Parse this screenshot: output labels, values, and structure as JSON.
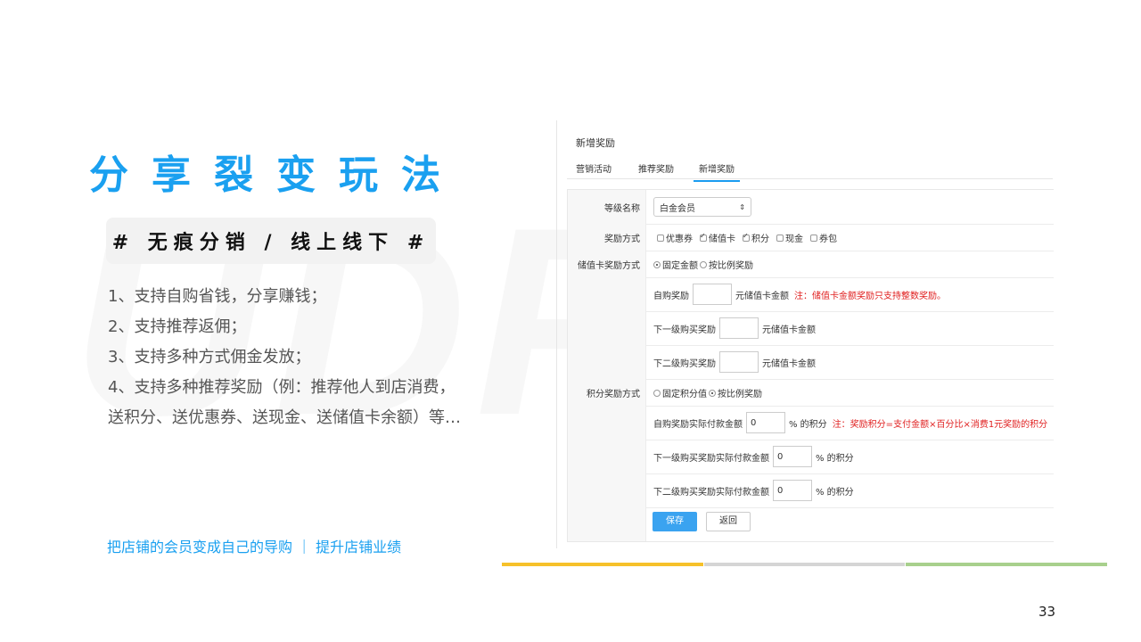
{
  "slide": {
    "title": "分享裂变玩法",
    "tag": "# 无痕分销 / 线上线下 #",
    "features": [
      "1、支持自购省钱，分享赚钱；",
      "2、支持推荐返佣；",
      "3、支持多种方式佣金发放；",
      "4、支持多种推荐奖励（例：推荐他人到店消费，",
      "送积分、送优惠券、送现金、送储值卡余额）等…"
    ],
    "slogan": "把店铺的会员变成自己的导购 ｜ 提升店铺业绩",
    "page_number": "33",
    "bar_colors": [
      "#f6c12a",
      "#d5d5d5",
      "#a8d08d"
    ]
  },
  "panel": {
    "title": "新增奖励",
    "tabs": [
      "营销活动",
      "推荐奖励",
      "新增奖励"
    ],
    "active_tab": "新增奖励",
    "accent_color": "#1a9cf0",
    "level": {
      "label": "等级名称",
      "value": "白金会员"
    },
    "reward_type": {
      "label": "奖励方式",
      "options": [
        {
          "label": "优惠券",
          "checked": false
        },
        {
          "label": "储值卡",
          "checked": true
        },
        {
          "label": "积分",
          "checked": true
        },
        {
          "label": "现金",
          "checked": false
        },
        {
          "label": "券包",
          "checked": false
        }
      ]
    },
    "card_reward": {
      "label": "储值卡奖励方式",
      "options": [
        {
          "label": "固定金额",
          "selected": true
        },
        {
          "label": "按比例奖励",
          "selected": false
        }
      ],
      "self_label": "自购奖励",
      "self_value": "",
      "self_unit": "元储值卡金额",
      "note": "注：储值卡金额奖励只支持整数奖励。",
      "level1_label": "下一级购买奖励",
      "level1_value": "",
      "level1_unit": "元储值卡金额",
      "level2_label": "下二级购买奖励",
      "level2_value": "",
      "level2_unit": "元储值卡金额"
    },
    "points_reward": {
      "label": "积分奖励方式",
      "options": [
        {
          "label": "固定积分值",
          "selected": false
        },
        {
          "label": "按比例奖励",
          "selected": true
        }
      ],
      "self_label": "自购奖励实际付款金额",
      "self_value": "0",
      "unit": "% 的积分",
      "note": "注：奖励积分=支付金额×百分比×消费1元奖励的积分",
      "level1_label": "下一级购买奖励实际付款金额",
      "level1_value": "0",
      "level2_label": "下二级购买奖励实际付款金额",
      "level2_value": "0"
    },
    "save_label": "保存",
    "back_label": "返回"
  }
}
